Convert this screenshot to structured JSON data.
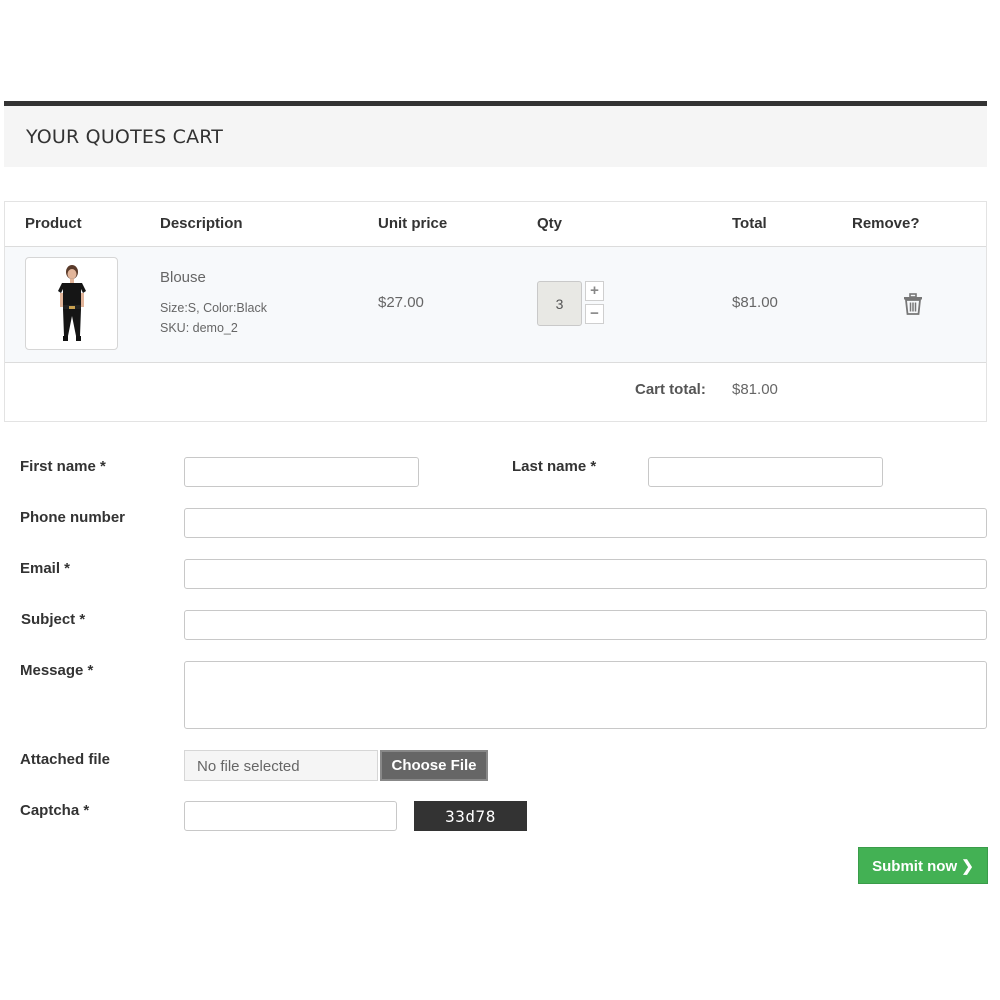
{
  "cart": {
    "title": "YOUR QUOTES CART",
    "columns": {
      "product": "Product",
      "description": "Description",
      "unit_price": "Unit price",
      "qty": "Qty",
      "total": "Total",
      "remove": "Remove?"
    },
    "items": [
      {
        "name": "Blouse",
        "attributes": "Size:S, Color:Black",
        "sku": "SKU: demo_2",
        "unit_price": "$27.00",
        "qty": "3",
        "total": "$81.00",
        "qty_increase": "+",
        "qty_decrease": "−"
      }
    ],
    "total_label": "Cart total:",
    "total_value": "$81.00"
  },
  "form": {
    "first_name_label": "First name *",
    "last_name_label": "Last name *",
    "phone_label": "Phone number",
    "email_label": "Email *",
    "subject_label": "Subject *",
    "message_label": "Message *",
    "attached_label": "Attached file",
    "file_status": "No file selected",
    "choose_file": "Choose File",
    "captcha_label": "Captcha *",
    "captcha_code": "33d78",
    "submit": "Submit now ❯"
  },
  "icons": {
    "trash": "trash-icon",
    "thumbnail": "product-thumbnail"
  },
  "colors": {
    "header_bar": "#333333",
    "submit_green": "#43b154",
    "captcha_bg": "#333333"
  }
}
